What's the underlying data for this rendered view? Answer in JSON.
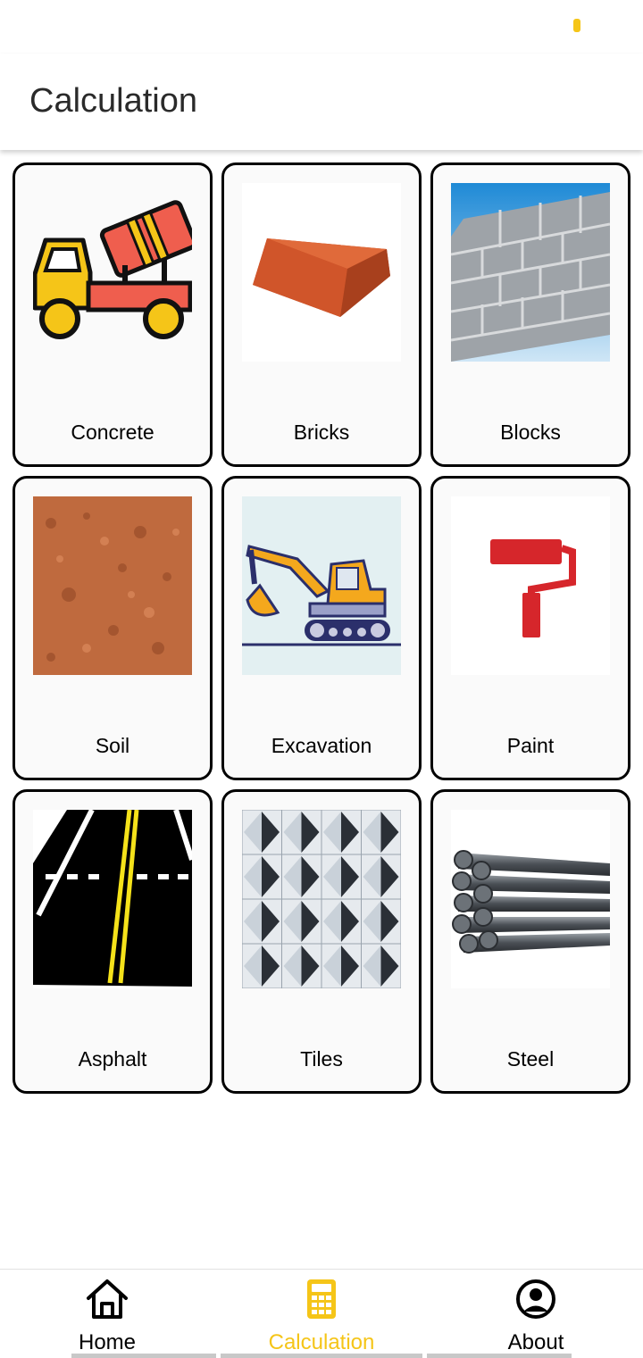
{
  "app": {
    "title": "Calculation"
  },
  "colors": {
    "accent": "#F5C518",
    "text": "#000000",
    "card_border": "#000000"
  },
  "tiles": [
    {
      "label": "Concrete",
      "icon": "concrete-mixer-truck-icon"
    },
    {
      "label": "Bricks",
      "icon": "brick-icon"
    },
    {
      "label": "Blocks",
      "icon": "block-wall-icon"
    },
    {
      "label": "Soil",
      "icon": "soil-icon"
    },
    {
      "label": "Excavation",
      "icon": "excavator-icon"
    },
    {
      "label": "Paint",
      "icon": "paint-roller-icon"
    },
    {
      "label": "Asphalt",
      "icon": "road-icon"
    },
    {
      "label": "Tiles",
      "icon": "tiles-icon"
    },
    {
      "label": "Steel",
      "icon": "steel-rebar-icon"
    }
  ],
  "bottom_nav": {
    "items": [
      {
        "label": "Home",
        "icon": "home-icon",
        "active": false
      },
      {
        "label": "Calculation",
        "icon": "calculator-icon",
        "active": true
      },
      {
        "label": "About",
        "icon": "user-circle-icon",
        "active": false
      }
    ]
  }
}
